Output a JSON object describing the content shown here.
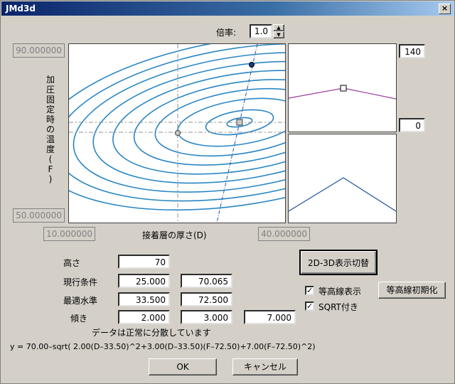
{
  "window": {
    "title": "JMd3d",
    "close_label": "×"
  },
  "zoom": {
    "label": "倍率:",
    "value": "1.0"
  },
  "plot": {
    "ylabel": "加圧固定時の温度(F)",
    "xlabel": "接着層の厚さ(D)",
    "y_max": "90.000000",
    "y_min": "50.000000",
    "x_min": "10.000000",
    "x_max": "40.000000"
  },
  "side": {
    "top_value": "140",
    "bottom_value": "0"
  },
  "form": {
    "height_label": "高さ",
    "height_value": "70",
    "current_label": "現行条件",
    "current_d": "25.000",
    "current_f": "70.065",
    "optimal_label": "最適水準",
    "optimal_d": "33.500",
    "optimal_f": "72.500",
    "slope_label": "傾き",
    "slope_1": "2.000",
    "slope_2": "3.000",
    "slope_3": "7.000"
  },
  "buttons": {
    "toggle_3d": "2D-3D表示切替",
    "reset_contour": "等高線初期化",
    "ok": "OK",
    "cancel": "キャンセル"
  },
  "checks": {
    "contour_label": "等高線表示",
    "contour_checked": true,
    "sqrt_label": "SQRT付き",
    "sqrt_checked": true,
    "check_mark": "✓"
  },
  "status": "データは正常に分散しています",
  "formula": "y = 70.00–sqrt( 2.00(D–33.50)^2+3.00(D–33.50)(F–72.50)+7.00(F–72.50)^2)",
  "colors": {
    "contour": "#2a86c4",
    "axis_line": "#2456a0",
    "upper_profile": "#9a3a9a",
    "lower_profile": "#2456a0"
  }
}
